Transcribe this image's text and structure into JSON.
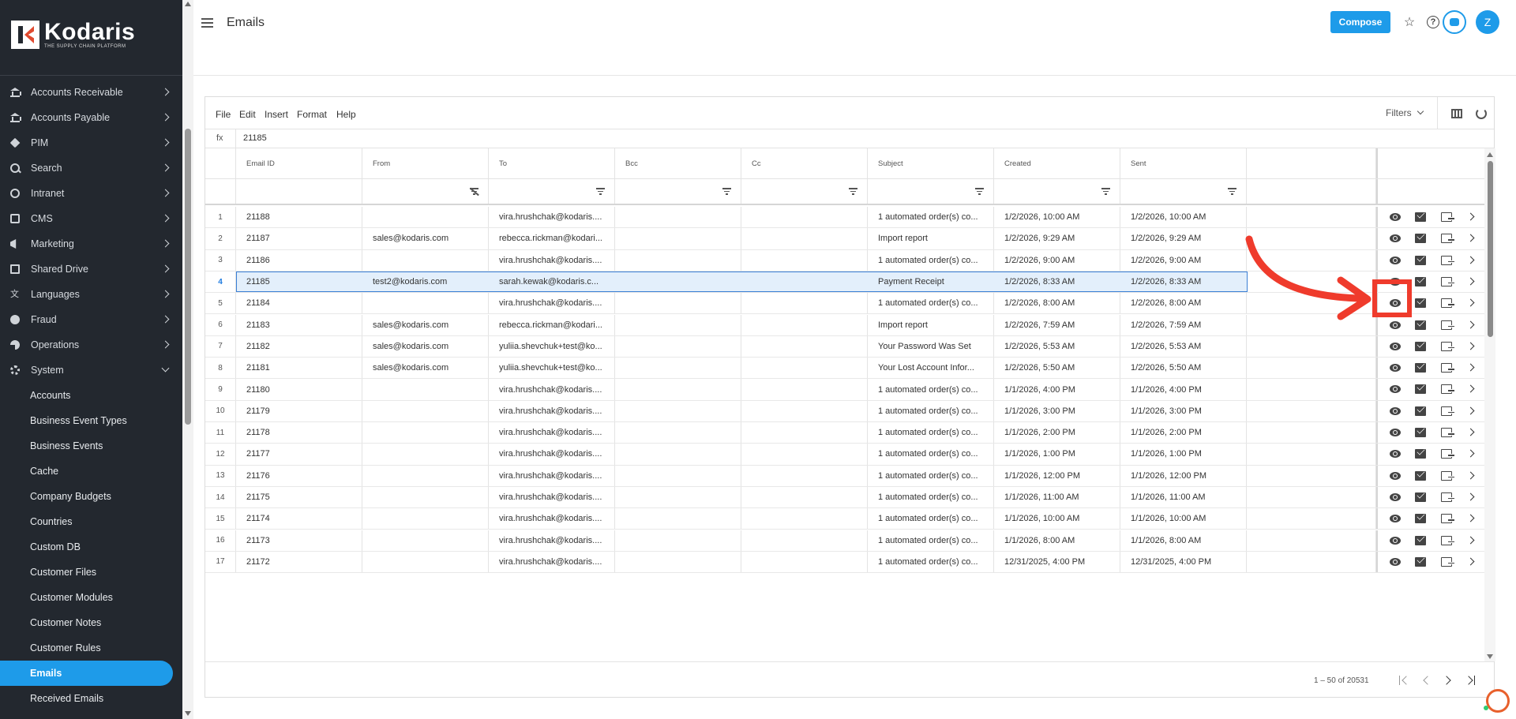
{
  "app": {
    "brand": "Kodaris",
    "tagline": "THE SUPPLY CHAIN PLATFORM"
  },
  "sidebar": {
    "items": [
      {
        "label": "Accounts Receivable",
        "icon": "bank-icon"
      },
      {
        "label": "Accounts Payable",
        "icon": "bank-icon"
      },
      {
        "label": "PIM",
        "icon": "tag-icon"
      },
      {
        "label": "Search",
        "icon": "search-icon"
      },
      {
        "label": "Intranet",
        "icon": "globe-icon"
      },
      {
        "label": "CMS",
        "icon": "monitor-icon"
      },
      {
        "label": "Marketing",
        "icon": "megaphone-icon"
      },
      {
        "label": "Shared Drive",
        "icon": "folder-icon"
      },
      {
        "label": "Languages",
        "icon": "translate-icon"
      },
      {
        "label": "Fraud",
        "icon": "fraud-icon"
      },
      {
        "label": "Operations",
        "icon": "pie-icon"
      },
      {
        "label": "System",
        "icon": "gear-icon"
      }
    ],
    "system_sub": [
      "Accounts",
      "Business Event Types",
      "Business Events",
      "Cache",
      "Company Budgets",
      "Countries",
      "Custom DB",
      "Customer Files",
      "Customer Modules",
      "Customer Notes",
      "Customer Rules",
      "Emails",
      "Received Emails"
    ],
    "active": "Emails"
  },
  "header": {
    "title": "Emails",
    "compose_label": "Compose",
    "avatar_initial": "Z"
  },
  "toolbar": {
    "menu": [
      "File",
      "Edit",
      "Insert",
      "Format",
      "Help"
    ],
    "filters_label": "Filters"
  },
  "formula_bar": {
    "label": "fx",
    "value": "21185"
  },
  "grid": {
    "columns": [
      "Email ID",
      "From",
      "To",
      "Bcc",
      "Cc",
      "Subject",
      "Created",
      "Sent"
    ],
    "selected_row": 4,
    "rows": [
      {
        "n": "1",
        "id": "21188",
        "from": "",
        "to": "vira.hrushchak@kodaris....",
        "bcc": "",
        "cc": "",
        "subject": "1 automated order(s) co...",
        "created": "1/2/2026, 10:00 AM",
        "sent": "1/2/2026, 10:00 AM"
      },
      {
        "n": "2",
        "id": "21187",
        "from": "sales@kodaris.com",
        "to": "rebecca.rickman@kodari...",
        "bcc": "",
        "cc": "",
        "subject": "Import report",
        "created": "1/2/2026, 9:29 AM",
        "sent": "1/2/2026, 9:29 AM"
      },
      {
        "n": "3",
        "id": "21186",
        "from": "",
        "to": "vira.hrushchak@kodaris....",
        "bcc": "",
        "cc": "",
        "subject": "1 automated order(s) co...",
        "created": "1/2/2026, 9:00 AM",
        "sent": "1/2/2026, 9:00 AM"
      },
      {
        "n": "4",
        "id": "21185",
        "from": "test2@kodaris.com",
        "to": "sarah.kewak@kodaris.c...",
        "bcc": "",
        "cc": "",
        "subject": "Payment Receipt",
        "created": "1/2/2026, 8:33 AM",
        "sent": "1/2/2026, 8:33 AM"
      },
      {
        "n": "5",
        "id": "21184",
        "from": "",
        "to": "vira.hrushchak@kodaris....",
        "bcc": "",
        "cc": "",
        "subject": "1 automated order(s) co...",
        "created": "1/2/2026, 8:00 AM",
        "sent": "1/2/2026, 8:00 AM"
      },
      {
        "n": "6",
        "id": "21183",
        "from": "sales@kodaris.com",
        "to": "rebecca.rickman@kodari...",
        "bcc": "",
        "cc": "",
        "subject": "Import report",
        "created": "1/2/2026, 7:59 AM",
        "sent": "1/2/2026, 7:59 AM"
      },
      {
        "n": "7",
        "id": "21182",
        "from": "sales@kodaris.com",
        "to": "yuliia.shevchuk+test@ko...",
        "bcc": "",
        "cc": "",
        "subject": "Your Password Was Set",
        "created": "1/2/2026, 5:53 AM",
        "sent": "1/2/2026, 5:53 AM"
      },
      {
        "n": "8",
        "id": "21181",
        "from": "sales@kodaris.com",
        "to": "yuliia.shevchuk+test@ko...",
        "bcc": "",
        "cc": "",
        "subject": "Your Lost Account Infor...",
        "created": "1/2/2026, 5:50 AM",
        "sent": "1/2/2026, 5:50 AM"
      },
      {
        "n": "9",
        "id": "21180",
        "from": "",
        "to": "vira.hrushchak@kodaris....",
        "bcc": "",
        "cc": "",
        "subject": "1 automated order(s) co...",
        "created": "1/1/2026, 4:00 PM",
        "sent": "1/1/2026, 4:00 PM"
      },
      {
        "n": "10",
        "id": "21179",
        "from": "",
        "to": "vira.hrushchak@kodaris....",
        "bcc": "",
        "cc": "",
        "subject": "1 automated order(s) co...",
        "created": "1/1/2026, 3:00 PM",
        "sent": "1/1/2026, 3:00 PM"
      },
      {
        "n": "11",
        "id": "21178",
        "from": "",
        "to": "vira.hrushchak@kodaris....",
        "bcc": "",
        "cc": "",
        "subject": "1 automated order(s) co...",
        "created": "1/1/2026, 2:00 PM",
        "sent": "1/1/2026, 2:00 PM"
      },
      {
        "n": "12",
        "id": "21177",
        "from": "",
        "to": "vira.hrushchak@kodaris....",
        "bcc": "",
        "cc": "",
        "subject": "1 automated order(s) co...",
        "created": "1/1/2026, 1:00 PM",
        "sent": "1/1/2026, 1:00 PM"
      },
      {
        "n": "13",
        "id": "21176",
        "from": "",
        "to": "vira.hrushchak@kodaris....",
        "bcc": "",
        "cc": "",
        "subject": "1 automated order(s) co...",
        "created": "1/1/2026, 12:00 PM",
        "sent": "1/1/2026, 12:00 PM"
      },
      {
        "n": "14",
        "id": "21175",
        "from": "",
        "to": "vira.hrushchak@kodaris....",
        "bcc": "",
        "cc": "",
        "subject": "1 automated order(s) co...",
        "created": "1/1/2026, 11:00 AM",
        "sent": "1/1/2026, 11:00 AM"
      },
      {
        "n": "15",
        "id": "21174",
        "from": "",
        "to": "vira.hrushchak@kodaris....",
        "bcc": "",
        "cc": "",
        "subject": "1 automated order(s) co...",
        "created": "1/1/2026, 10:00 AM",
        "sent": "1/1/2026, 10:00 AM"
      },
      {
        "n": "16",
        "id": "21173",
        "from": "",
        "to": "vira.hrushchak@kodaris....",
        "bcc": "",
        "cc": "",
        "subject": "1 automated order(s) co...",
        "created": "1/1/2026, 8:00 AM",
        "sent": "1/1/2026, 8:00 AM"
      },
      {
        "n": "17",
        "id": "21172",
        "from": "",
        "to": "vira.hrushchak@kodaris....",
        "bcc": "",
        "cc": "",
        "subject": "1 automated order(s) co...",
        "created": "12/31/2025, 4:00 PM",
        "sent": "12/31/2025, 4:00 PM"
      }
    ]
  },
  "pager": {
    "info": "1 – 50 of 20531"
  },
  "colors": {
    "sidebar_bg": "#23282f",
    "accent": "#1e9be9",
    "annotation": "#ef3b2c",
    "selection_bg": "#e3effb"
  }
}
